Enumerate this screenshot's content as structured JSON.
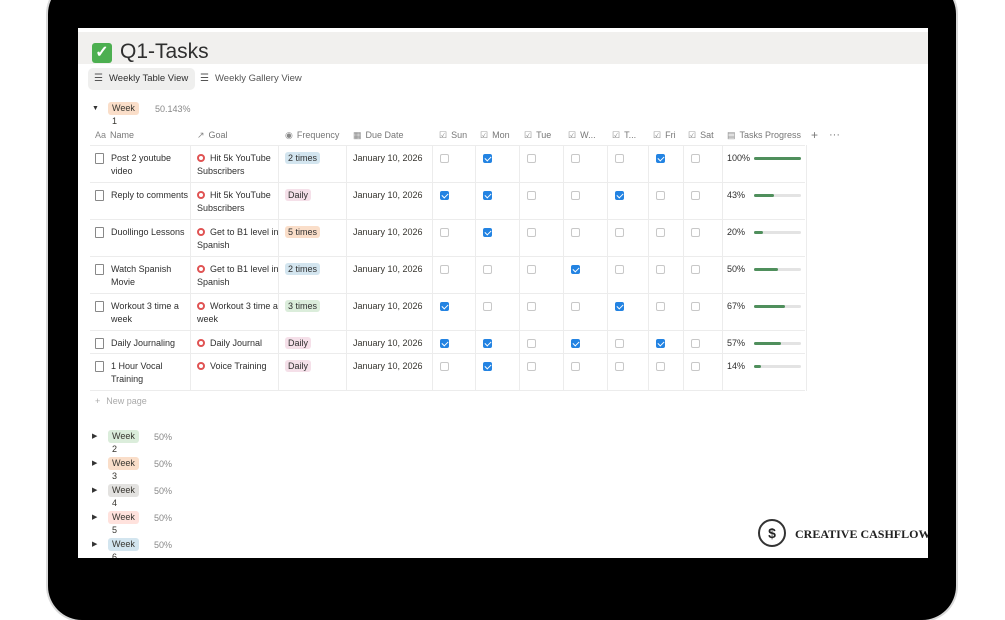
{
  "page": {
    "title": "Q1-Tasks"
  },
  "views": [
    {
      "label": "Weekly Table View",
      "active": true
    },
    {
      "label": "Weekly Gallery View",
      "active": false
    }
  ],
  "group": {
    "label": "Week 1",
    "percent": "50.143%"
  },
  "columns": [
    "Name",
    "Goal",
    "Frequency",
    "Due Date",
    "Sun",
    "Mon",
    "Tue",
    "W...",
    "T...",
    "Fri",
    "Sat",
    "Tasks Progress"
  ],
  "rows": [
    {
      "name": "Post 2 youtube video",
      "goal": "Hit 5k YouTube Subscribers",
      "frequency": "2 times",
      "due": "January 10, 2026",
      "days": [
        false,
        true,
        false,
        false,
        false,
        true,
        false
      ],
      "progress": "100%",
      "progress_value": 1.0
    },
    {
      "name": "Reply to comments",
      "goal": "Hit 5k YouTube Subscribers",
      "frequency": "Daily",
      "due": "January 10, 2026",
      "days": [
        true,
        true,
        false,
        false,
        true,
        false,
        false
      ],
      "progress": "43%",
      "progress_value": 0.43
    },
    {
      "name": "Duollingo Lessons",
      "goal": "Get to B1 level in Spanish",
      "frequency": "5 times",
      "due": "January 10, 2026",
      "days": [
        false,
        true,
        false,
        false,
        false,
        false,
        false
      ],
      "progress": "20%",
      "progress_value": 0.2
    },
    {
      "name": "Watch Spanish Movie",
      "goal": "Get to B1 level in Spanish",
      "frequency": "2 times",
      "due": "January 10, 2026",
      "days": [
        false,
        false,
        false,
        true,
        false,
        false,
        false
      ],
      "progress": "50%",
      "progress_value": 0.5
    },
    {
      "name": "Workout 3 time a week",
      "goal": "Workout 3 time a week",
      "frequency": "3 times",
      "due": "January 10, 2026",
      "days": [
        true,
        false,
        false,
        false,
        true,
        false,
        false
      ],
      "progress": "67%",
      "progress_value": 0.67
    },
    {
      "name": "Daily Journaling",
      "goal": "Daily Journal",
      "frequency": "Daily",
      "due": "January 10, 2026",
      "days": [
        true,
        true,
        false,
        true,
        false,
        true,
        false
      ],
      "progress": "57%",
      "progress_value": 0.57
    },
    {
      "name": "1 Hour Vocal Training",
      "goal": "Voice Training",
      "frequency": "Daily",
      "due": "January 10, 2026",
      "days": [
        false,
        true,
        false,
        false,
        false,
        false,
        false
      ],
      "progress": "14%",
      "progress_value": 0.14
    }
  ],
  "new_page_label": "New page",
  "other_groups": [
    {
      "label": "Week 2",
      "percent": "50%"
    },
    {
      "label": "Week 3",
      "percent": "50%"
    },
    {
      "label": "Week 4",
      "percent": "50%"
    },
    {
      "label": "Week 5",
      "percent": "50%"
    },
    {
      "label": "Week 6",
      "percent": "50%"
    }
  ],
  "brand": {
    "name": "CREATIVE CASHFLOW",
    "mark": "$"
  },
  "colors": {
    "checkbox": "#2383e2",
    "progress": "#4f8f5c",
    "freq_2_times": "#d3e5ef",
    "freq_daily": "#f5e0e9",
    "freq_5_times": "#fadec9",
    "freq_3_times": "#dbeddb",
    "week_1": "#fadec9",
    "week_2": "#dbeddb",
    "week_3": "#fadec9",
    "week_4": "#e3e2e0",
    "week_5": "#ffe2dd",
    "week_6": "#d3e5ef"
  }
}
